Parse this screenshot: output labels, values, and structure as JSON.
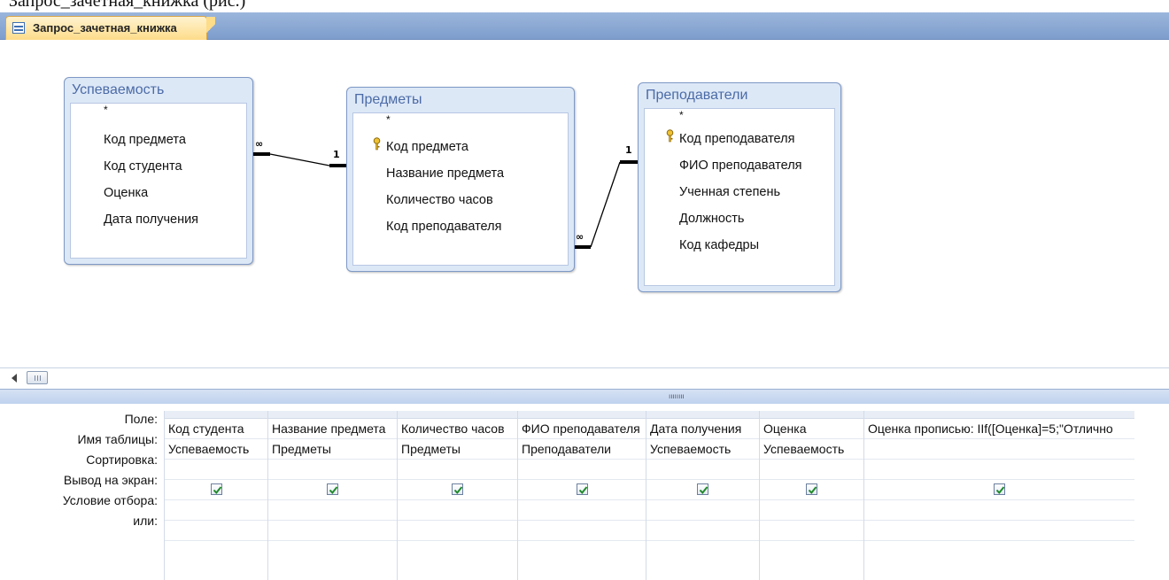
{
  "document": {
    "caption": "Запрос_зачетная_книжка (рис.)"
  },
  "tab": {
    "title": "Запрос_зачетная_книжка",
    "icon": "query-icon"
  },
  "tables": [
    {
      "title": "Успеваемость",
      "fields": [
        "*",
        "Код предмета",
        "Код студента",
        "Оценка",
        "Дата получения"
      ],
      "key_field": null
    },
    {
      "title": "Предметы",
      "fields": [
        "*",
        "Код предмета",
        "Название предмета",
        "Количество часов",
        "Код преподавателя"
      ],
      "key_field": "Код предмета"
    },
    {
      "title": "Преподаватели",
      "fields": [
        "*",
        "Код преподавателя",
        "ФИО преподавателя",
        "Ученная степень",
        "Должность",
        "Код кафедры"
      ],
      "key_field": "Код преподавателя"
    }
  ],
  "relations": [
    {
      "one_label": "1",
      "many_label": "∞"
    },
    {
      "one_label": "1",
      "many_label": "∞"
    }
  ],
  "grid": {
    "row_labels": [
      "Поле:",
      "Имя таблицы:",
      "Сортировка:",
      "Вывод на экран:",
      "Условие отбора:",
      "или:"
    ],
    "columns": [
      {
        "field": "Код студента",
        "table": "Успеваемость",
        "sort": "",
        "show": true,
        "criteria": "",
        "or": ""
      },
      {
        "field": "Название предмета",
        "table": "Предметы",
        "sort": "",
        "show": true,
        "criteria": "",
        "or": ""
      },
      {
        "field": "Количество часов",
        "table": "Предметы",
        "sort": "",
        "show": true,
        "criteria": "",
        "or": ""
      },
      {
        "field": "ФИО преподавателя",
        "table": "Преподаватели",
        "sort": "",
        "show": true,
        "criteria": "",
        "or": ""
      },
      {
        "field": "Дата получения",
        "table": "Успеваемость",
        "sort": "",
        "show": true,
        "criteria": "",
        "or": ""
      },
      {
        "field": "Оценка",
        "table": "Успеваемость",
        "sort": "",
        "show": true,
        "criteria": "",
        "or": ""
      },
      {
        "field": "Оценка прописью: IIf([Оценка]=5;\"Отлично",
        "table": "",
        "sort": "",
        "show": true,
        "criteria": "",
        "or": ""
      }
    ]
  },
  "colors": {
    "tab_active": "#fddc8a",
    "tabbar": "#8eabd6",
    "table_header": "#dde8f7",
    "checkbox_mark": "#1f8a2a"
  }
}
